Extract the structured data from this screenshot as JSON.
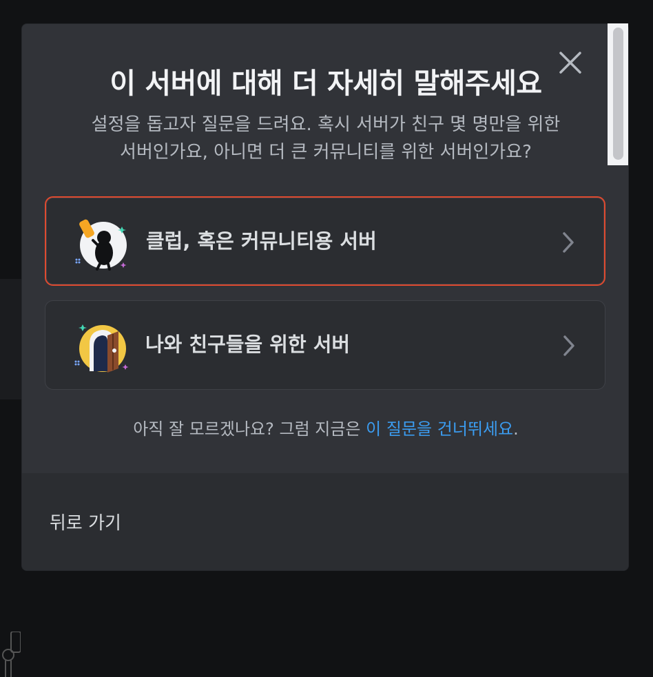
{
  "modal": {
    "title": "이 서버에 대해 더 자세히 말해주세요",
    "subtitle_line1": "설정을 돕고자 질문을 드려요. 혹시 서버가 친구 몇 명만을 위한",
    "subtitle_line2": "서버인가요, 아니면 더 큰 커뮤니티를 위한 서버인가요?",
    "close_icon": "close-icon"
  },
  "options": [
    {
      "label": "클럽, 혹은 커뮤니티용 서버",
      "icon": "club-community-icon",
      "selected": true
    },
    {
      "label": "나와 친구들을 위한 서버",
      "icon": "friends-door-icon",
      "selected": false
    }
  ],
  "skip": {
    "prefix": "아직 잘 모르겠나요? 그럼 지금은 ",
    "link": "이 질문을 건너뛰세요",
    "suffix": "."
  },
  "footer": {
    "back_label": "뒤로 가기"
  },
  "colors": {
    "modal_bg": "#313338",
    "footer_bg": "#2b2d31",
    "selected_border": "#e04a2f",
    "link": "#3b9cf0"
  }
}
